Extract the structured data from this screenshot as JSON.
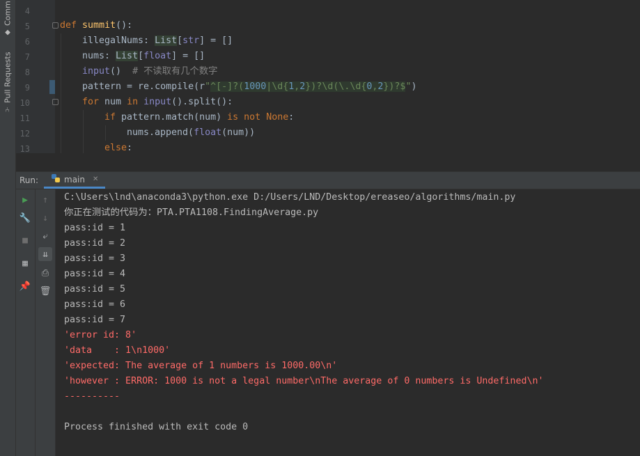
{
  "left_strip": {
    "commit_label": "Comm",
    "pull_requests_label": "Pull Requests"
  },
  "editor": {
    "line_numbers": [
      "4",
      "5",
      "6",
      "7",
      "8",
      "9",
      "10",
      "11",
      "12",
      "13"
    ],
    "lines": {
      "l5": {
        "kw": "def",
        "fn": "summit",
        "rest": "():"
      },
      "l6": {
        "a": "illegalNums: ",
        "t": "List",
        "b": "[",
        "c": "str",
        "d": "] = []"
      },
      "l7": {
        "a": "nums: ",
        "t": "List",
        "b": "[",
        "c": "float",
        "d": "] = []"
      },
      "l8": {
        "a": "input",
        "b": "()  ",
        "c": "# 不读取有几个数字"
      },
      "l9": {
        "a": "pattern = re.compile(r",
        "q1": "\"",
        "r1": "^[-]?(",
        "n1": "1000",
        "r2": "|\\d{",
        "n2": "1",
        "r3": ",",
        "n3": "2",
        "r4": "})?\\d(\\.\\d{",
        "n4": "0",
        "r5": ",",
        "n6": "2",
        "r6": "})?$",
        "q2": "\"",
        "z": ")"
      },
      "l10": {
        "kw": "for",
        "a": " num ",
        "kw2": "in",
        "b": " ",
        "bi": "input",
        "c": "().split():"
      },
      "l11": {
        "kw": "if",
        "a": " pattern.match(num) ",
        "kw2": "is not",
        "b": " ",
        "kw3": "None",
        "c": ":"
      },
      "l12": {
        "a": "nums.append(",
        "bi": "float",
        "b": "(num))"
      },
      "l13": {
        "kw": "else",
        "c": ":"
      }
    }
  },
  "run_panel": {
    "label": "Run:",
    "tab_label": "main",
    "output": [
      {
        "text": "C:\\Users\\lnd\\anaconda3\\python.exe D:/Users/LND/Desktop/ereaseo/algorithms/main.py",
        "type": "normal"
      },
      {
        "text": "你正在测试的代码为：PTA.PTA1108.FindingAverage.py",
        "type": "normal"
      },
      {
        "text": "pass:id = 1",
        "type": "normal"
      },
      {
        "text": "pass:id = 2",
        "type": "normal"
      },
      {
        "text": "pass:id = 3",
        "type": "normal"
      },
      {
        "text": "pass:id = 4",
        "type": "normal"
      },
      {
        "text": "pass:id = 5",
        "type": "normal"
      },
      {
        "text": "pass:id = 6",
        "type": "normal"
      },
      {
        "text": "pass:id = 7",
        "type": "normal"
      },
      {
        "text": "'error id: 8'",
        "type": "err"
      },
      {
        "text": "'data    : 1\\n1000'",
        "type": "err"
      },
      {
        "text": "'expected: The average of 1 numbers is 1000.00\\n'",
        "type": "err"
      },
      {
        "text": "'however : ERROR: 1000 is not a legal number\\nThe average of 0 numbers is Undefined\\n'",
        "type": "err"
      },
      {
        "text": "----------",
        "type": "err"
      },
      {
        "text": "",
        "type": "normal"
      },
      {
        "text": "Process finished with exit code 0",
        "type": "normal"
      }
    ]
  },
  "colors": {
    "accent_run_green": "#499c54",
    "error_text": "#ff6b68"
  }
}
